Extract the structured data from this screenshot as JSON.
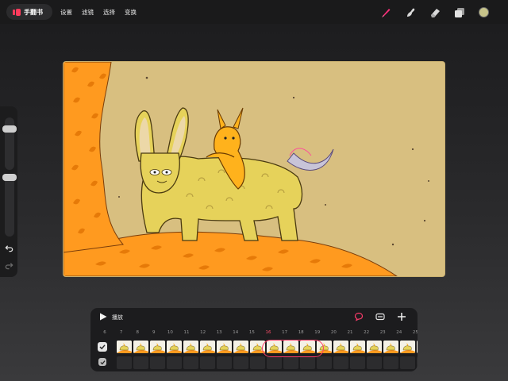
{
  "topbar": {
    "app_title": "手翻书",
    "menu": [
      "设置",
      "滤镜",
      "选择",
      "变换"
    ],
    "tools": [
      {
        "name": "brush-icon",
        "color": "#ff2e7a"
      },
      {
        "name": "smudge-icon",
        "color": "#d9d9d9"
      },
      {
        "name": "eraser-icon",
        "color": "#d9d9d9"
      },
      {
        "name": "layers-icon",
        "color": "#d9d9d9"
      }
    ],
    "current_color": "#c7c48a"
  },
  "timeline": {
    "play_label": "播放",
    "ruler": [
      "6",
      "7",
      "8",
      "9",
      "10",
      "11",
      "12",
      "13",
      "14",
      "15",
      "16",
      "17",
      "18",
      "19",
      "20",
      "21",
      "22",
      "23",
      "24",
      "25"
    ],
    "active_frame": "16",
    "accent": "#ff3b5c"
  },
  "colors": {
    "canvas_bg": "#d8bf80",
    "tree": "#ff9a1f",
    "creature": "#e6d25a",
    "rider": "#ffb21c"
  }
}
